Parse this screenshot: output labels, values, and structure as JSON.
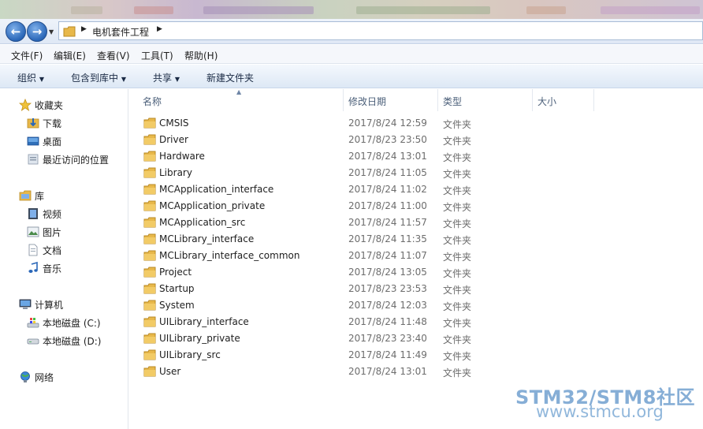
{
  "address": {
    "path": [
      "电机套件工程"
    ]
  },
  "menu": [
    "文件(F)",
    "编辑(E)",
    "查看(V)",
    "工具(T)",
    "帮助(H)"
  ],
  "toolbar": {
    "organize": "组织",
    "include_library": "包含到库中",
    "share": "共享",
    "new_folder": "新建文件夹"
  },
  "nav": {
    "favorites": "收藏夹",
    "downloads": "下载",
    "desktop": "桌面",
    "recent": "最近访问的位置",
    "libraries": "库",
    "videos": "视频",
    "pictures": "图片",
    "documents": "文档",
    "music": "音乐",
    "computer": "计算机",
    "drive_c": "本地磁盘 (C:)",
    "drive_d": "本地磁盘 (D:)",
    "network": "网络"
  },
  "columns": {
    "name": "名称",
    "date": "修改日期",
    "type": "类型",
    "size": "大小"
  },
  "files": [
    {
      "name": "CMSIS",
      "date": "2017/8/24 12:59",
      "type": "文件夹"
    },
    {
      "name": "Driver",
      "date": "2017/8/23 23:50",
      "type": "文件夹"
    },
    {
      "name": "Hardware",
      "date": "2017/8/24 13:01",
      "type": "文件夹"
    },
    {
      "name": "Library",
      "date": "2017/8/24 11:05",
      "type": "文件夹"
    },
    {
      "name": "MCApplication_interface",
      "date": "2017/8/24 11:02",
      "type": "文件夹"
    },
    {
      "name": "MCApplication_private",
      "date": "2017/8/24 11:00",
      "type": "文件夹"
    },
    {
      "name": "MCApplication_src",
      "date": "2017/8/24 11:57",
      "type": "文件夹"
    },
    {
      "name": "MCLibrary_interface",
      "date": "2017/8/24 11:35",
      "type": "文件夹"
    },
    {
      "name": "MCLibrary_interface_common",
      "date": "2017/8/24 11:07",
      "type": "文件夹"
    },
    {
      "name": "Project",
      "date": "2017/8/24 13:05",
      "type": "文件夹"
    },
    {
      "name": "Startup",
      "date": "2017/8/23 23:53",
      "type": "文件夹"
    },
    {
      "name": "System",
      "date": "2017/8/24 12:03",
      "type": "文件夹"
    },
    {
      "name": "UILibrary_interface",
      "date": "2017/8/24 11:48",
      "type": "文件夹"
    },
    {
      "name": "UILibrary_private",
      "date": "2017/8/23 23:40",
      "type": "文件夹"
    },
    {
      "name": "UILibrary_src",
      "date": "2017/8/24 11:49",
      "type": "文件夹"
    },
    {
      "name": "User",
      "date": "2017/8/24 13:01",
      "type": "文件夹"
    }
  ],
  "watermark": {
    "line1": "STM32/STM8社区",
    "line2": "www.stmcu.org"
  },
  "colors": {
    "folder": "#e8b84a",
    "accent": "#2a67b8",
    "watermark": "#7aa6d2"
  }
}
